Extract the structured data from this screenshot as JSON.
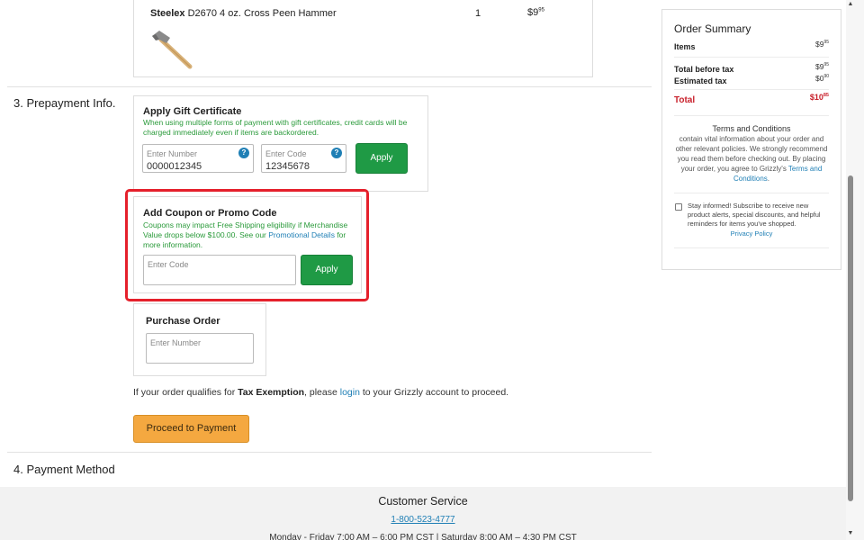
{
  "cart_item": {
    "brand": "Steelex",
    "name": " D2670 4 oz. Cross Peen Hammer",
    "qty": "1",
    "price_dollars": "$9",
    "price_cents": "95"
  },
  "prepayment": {
    "section_title": "3. Prepayment Info.",
    "gift": {
      "title": "Apply Gift Certificate",
      "note": "When using multiple forms of payment with gift certificates, credit cards will be charged immediately even if items are backordered.",
      "number_placeholder": "Enter Number",
      "number_value": "0000012345",
      "code_placeholder": "Enter Code",
      "code_value": "12345678",
      "help": "?",
      "apply": "Apply"
    },
    "coupon": {
      "title": "Add Coupon or Promo Code",
      "note_pre": "Coupons may impact Free Shipping eligibility if Merchandise Value drops below $100.00. See our ",
      "note_link": "Promotional Details",
      "note_post": " for more information.",
      "code_placeholder": "Enter Code",
      "apply": "Apply"
    },
    "purchase_order": {
      "title": "Purchase Order",
      "number_placeholder": "Enter Number"
    },
    "tax": {
      "pre": "If your order qualifies for ",
      "bold": "Tax Exemption",
      "mid": ", please ",
      "link": "login",
      "post": " to your Grizzly account to proceed."
    },
    "proceed_button": "Proceed to Payment"
  },
  "payment_method": {
    "section_title": "4. Payment Method"
  },
  "summary": {
    "title": "Order Summary",
    "items_label": "Items",
    "items_dollars": "$9",
    "items_cents": "95",
    "before_tax_label": "Total before tax",
    "before_tax_dollars": "$9",
    "before_tax_cents": "95",
    "tax_label": "Estimated tax",
    "tax_dollars": "$0",
    "tax_cents": "90",
    "total_label": "Total",
    "total_dollars": "$10",
    "total_cents": "85",
    "terms_title": "Terms and Conditions",
    "terms_body": "contain vital information about your order and other relevant policies. We strongly recommend you read them before checking out. By placing your order, you agree to Grizzly's ",
    "terms_link": "Terms and Conditions",
    "terms_end": ".",
    "subscribe": "Stay informed! Subscribe to receive new product alerts, special discounts, and helpful reminders for items you've shopped.",
    "privacy": "Privacy Policy"
  },
  "footer": {
    "title": "Customer Service",
    "phone": "1-800-523-4777",
    "hours": "Monday - Friday 7:00 AM – 6:00 PM CST | Saturday 8:00 AM – 4:30 PM CST"
  },
  "colors": {
    "accent_green": "#1f9a45",
    "highlight_red": "#e5202b",
    "proceed_orange": "#f4a840",
    "link_blue": "#1f7fb5"
  }
}
